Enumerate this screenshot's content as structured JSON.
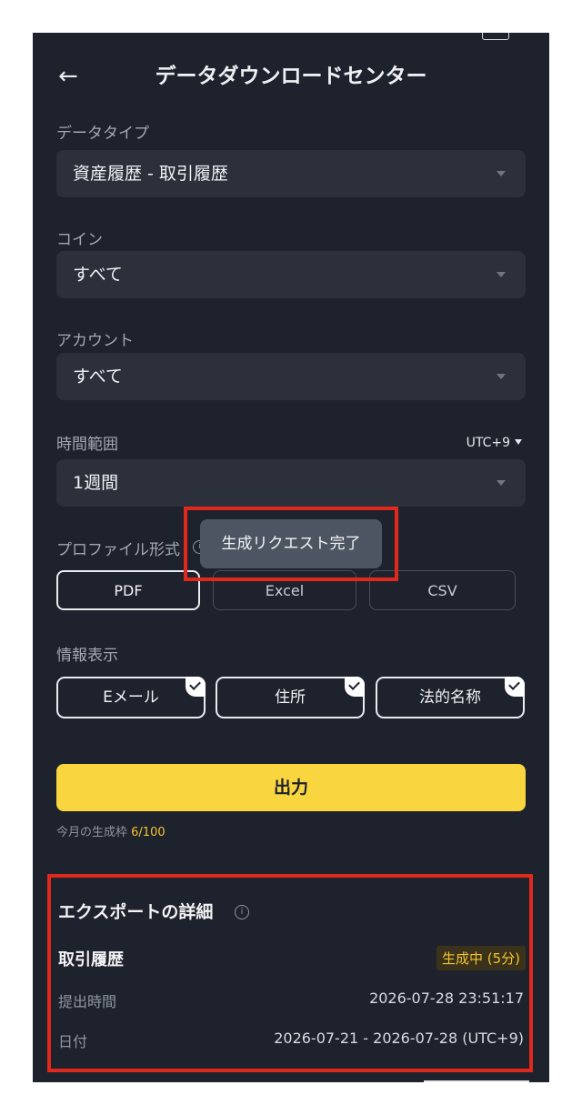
{
  "header": {
    "back_icon": "arrow-left-icon",
    "title": "データダウンロードセンター"
  },
  "form": {
    "data_type": {
      "label": "データタイプ",
      "value": "資産履歴 - 取引履歴"
    },
    "coin": {
      "label": "コイン",
      "value": "すべて"
    },
    "account": {
      "label": "アカウント",
      "value": "すべて"
    },
    "time_range": {
      "label": "時間範囲",
      "value": "1週間",
      "timezone": "UTC+9"
    },
    "profile_format": {
      "label": "プロファイル形式",
      "options": [
        "PDF",
        "Excel",
        "CSV"
      ],
      "selected": "PDF"
    },
    "info_display": {
      "label": "情報表示",
      "options": [
        "Eメール",
        "住所",
        "法的名称"
      ]
    }
  },
  "export_button": "出力",
  "quota": {
    "label": "今月の生成枠",
    "value": "6/100"
  },
  "toast": "生成リクエスト完了",
  "details": {
    "title": "エクスポートの詳細",
    "record_title": "取引履歴",
    "status": "生成中 (5分)",
    "submit_time_label": "提出時間",
    "submit_time": "2026-07-28 23:51:17",
    "date_label": "日付",
    "date_range": "2026-07-21 - 2026-07-28 (UTC+9)"
  },
  "colors": {
    "accent": "#f9d63f",
    "background": "#1e222c",
    "highlight_box": "#e0281c"
  }
}
